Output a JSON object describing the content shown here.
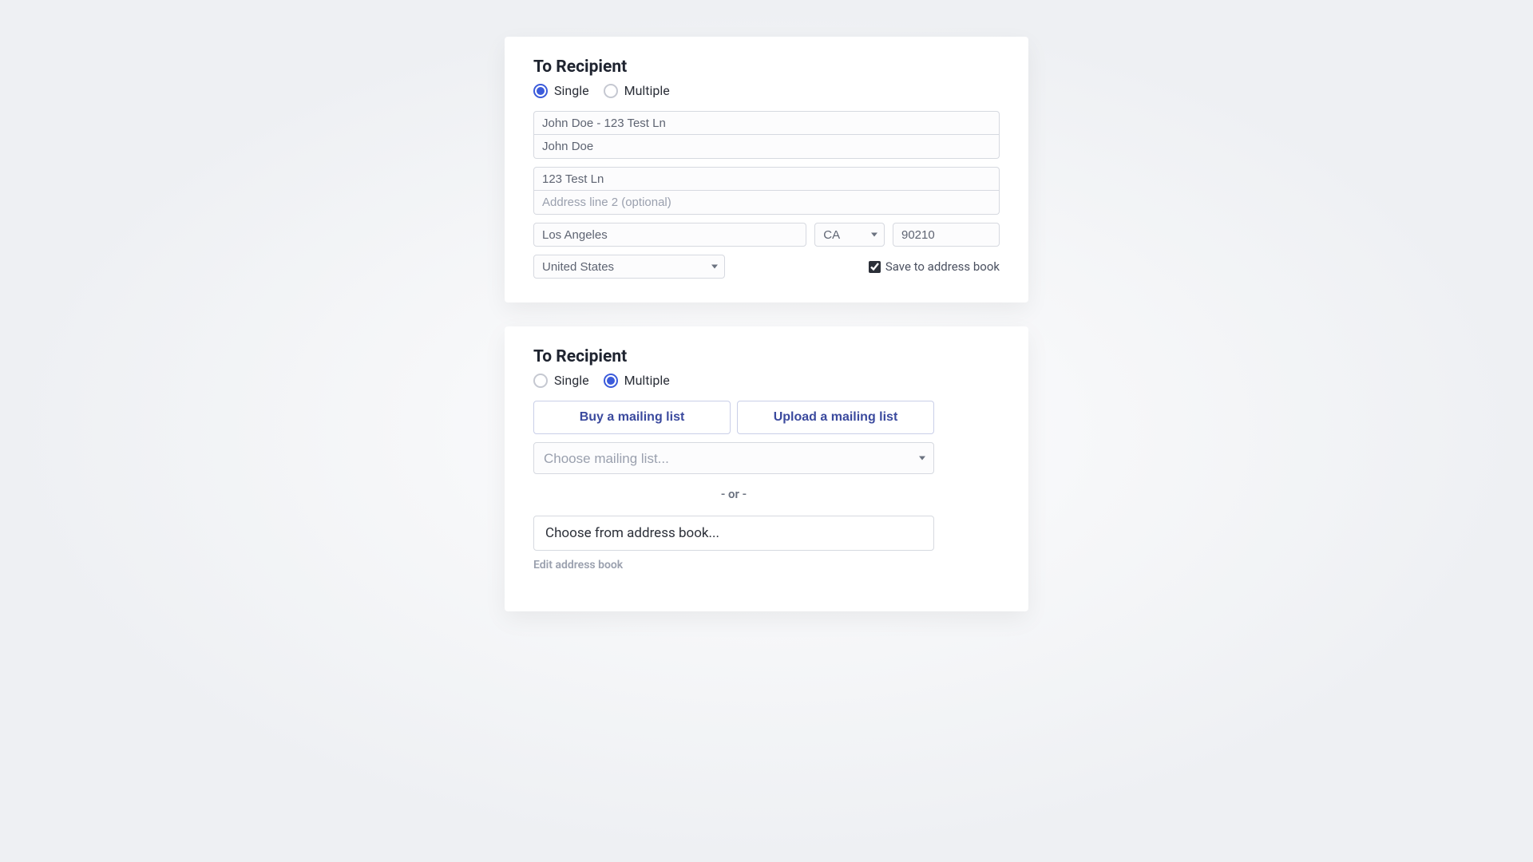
{
  "card1": {
    "title": "To Recipient",
    "radio": {
      "single": "Single",
      "multiple": "Multiple"
    },
    "search_value": "John Doe - 123 Test Ln",
    "name_value": "John Doe",
    "addr1_value": "123 Test Ln",
    "addr2_placeholder": "Address line 2 (optional)",
    "city_value": "Los Angeles",
    "state_value": "CA",
    "zip_value": "90210",
    "country_value": "United States",
    "save_label": "Save to address book"
  },
  "card2": {
    "title": "To Recipient",
    "radio": {
      "single": "Single",
      "multiple": "Multiple"
    },
    "buy_label": "Buy a mailing list",
    "upload_label": "Upload a mailing list",
    "choose_list_placeholder": "Choose mailing list...",
    "or_text": "- or -",
    "choose_ab_text": "Choose from address book...",
    "edit_ab_text": "Edit address book"
  }
}
